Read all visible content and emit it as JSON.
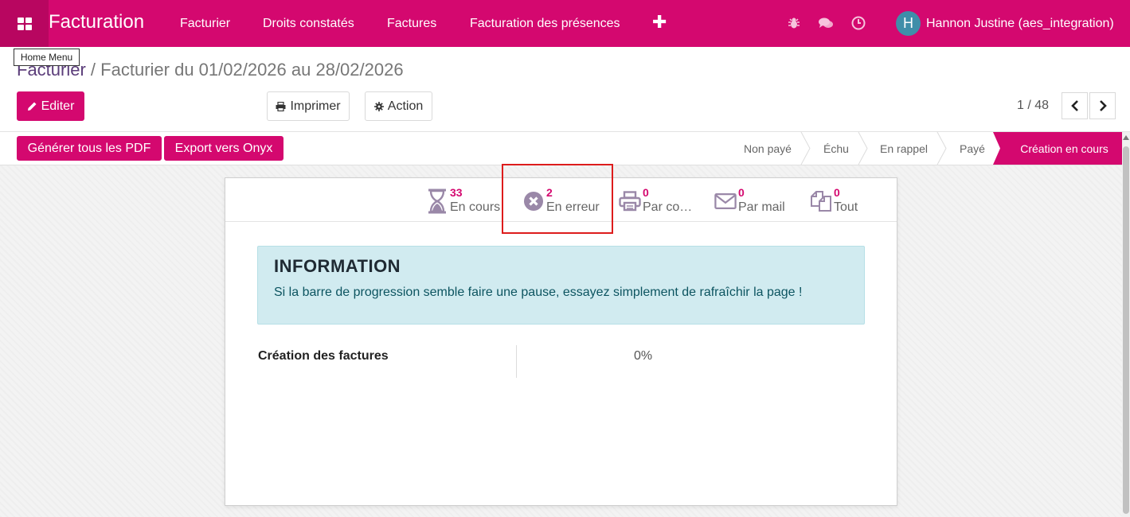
{
  "topbar": {
    "app_title": "Facturation",
    "menu": [
      {
        "label": "Facturier"
      },
      {
        "label": "Droits constatés"
      },
      {
        "label": "Factures"
      },
      {
        "label": "Facturation des présences"
      }
    ],
    "plus_label": "✚",
    "user": {
      "initial": "H",
      "name": "Hannon Justine (aes_integration)"
    },
    "brand_color": "#d4086f"
  },
  "tooltip": {
    "text": "Home Menu"
  },
  "breadcrumb": {
    "parent": "Facturier",
    "separator": "/",
    "current": "Facturier du 01/02/2026 au 28/02/2026"
  },
  "buttons": {
    "edit": "Editer",
    "print": "Imprimer",
    "action": "Action",
    "generate_pdf": "Générer tous les PDF",
    "export_onyx": "Export vers Onyx"
  },
  "pager": {
    "value": "1 / 48"
  },
  "statusbar": {
    "stages": [
      {
        "label": "Non payé",
        "active": false
      },
      {
        "label": "Échu",
        "active": false
      },
      {
        "label": "En rappel",
        "active": false
      },
      {
        "label": "Payé",
        "active": false
      },
      {
        "label": "Création en cours",
        "active": true
      }
    ]
  },
  "stats": [
    {
      "value": "33",
      "label": "En cours",
      "icon": "hourglass-icon"
    },
    {
      "value": "2",
      "label": "En erreur",
      "icon": "times-circle-icon"
    },
    {
      "value": "0",
      "label": "Par co…",
      "icon": "print-icon"
    },
    {
      "value": "0",
      "label": "Par mail",
      "icon": "envelope-icon"
    },
    {
      "value": "0",
      "label": "Tout",
      "icon": "copy-icon"
    }
  ],
  "alert": {
    "title": "INFORMATION",
    "text": "Si la barre de progression semble faire une pause, essayez simplement de rafraîchir la page !"
  },
  "progress": {
    "label": "Création des factures",
    "value": "0%"
  }
}
